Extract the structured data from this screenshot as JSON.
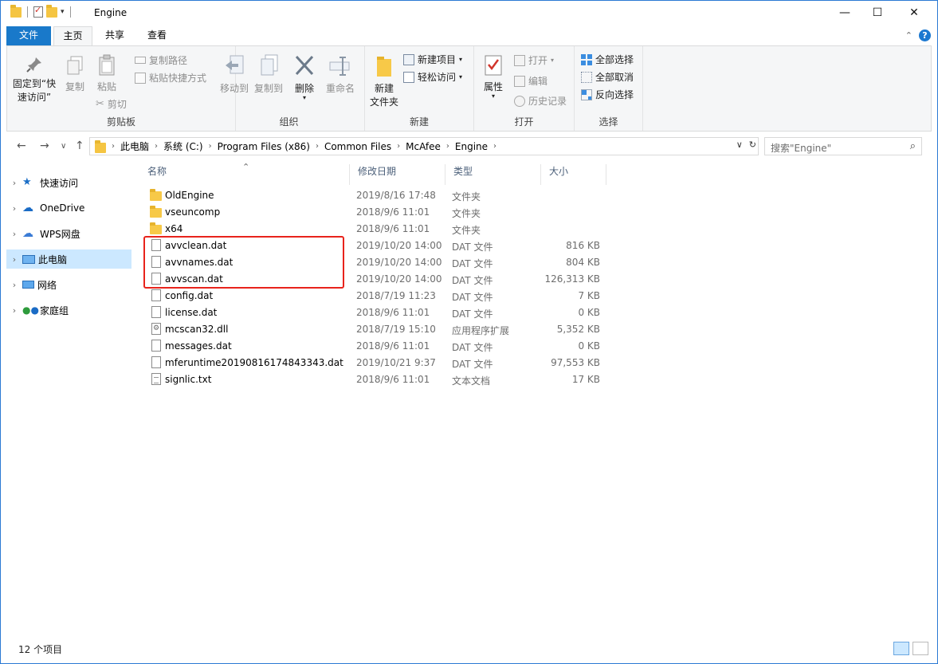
{
  "window": {
    "title": "Engine",
    "minimize_icon": "minimize-icon",
    "maximize_icon": "maximize-icon",
    "close_icon": "close-icon"
  },
  "tabs": {
    "file": "文件",
    "home": "主页",
    "share": "共享",
    "view": "查看"
  },
  "ribbon": {
    "pin_label_1": "固定到“快",
    "pin_label_2": "速访问”",
    "copy": "复制",
    "paste": "粘贴",
    "copy_path": "复制路径",
    "paste_shortcut": "粘贴快捷方式",
    "cut": "剪切",
    "clipboard_group": "剪贴板",
    "move_to": "移动到",
    "copy_to": "复制到",
    "delete": "删除",
    "rename": "重命名",
    "organize_group": "组织",
    "new_folder_1": "新建",
    "new_folder_2": "文件夹",
    "new_item": "新建项目",
    "easy_access": "轻松访问",
    "new_group": "新建",
    "properties": "属性",
    "open": "打开",
    "edit": "编辑",
    "history": "历史记录",
    "open_group": "打开",
    "select_all": "全部选择",
    "select_none": "全部取消",
    "invert_selection": "反向选择",
    "select_group": "选择"
  },
  "address": {
    "crumbs": [
      "此电脑",
      "系统 (C:)",
      "Program Files (x86)",
      "Common Files",
      "McAfee",
      "Engine"
    ]
  },
  "search": {
    "placeholder": "搜索\"Engine\""
  },
  "sidebar": {
    "items": [
      {
        "label": "快速访问",
        "icon": "star-icon"
      },
      {
        "label": "OneDrive",
        "icon": "cloud-icon"
      },
      {
        "label": "WPS网盘",
        "icon": "cloud-outline-icon"
      },
      {
        "label": "此电脑",
        "icon": "computer-icon"
      },
      {
        "label": "网络",
        "icon": "network-icon"
      },
      {
        "label": "家庭组",
        "icon": "homegroup-icon"
      }
    ]
  },
  "columns": {
    "name": "名称",
    "date": "修改日期",
    "type": "类型",
    "size": "大小"
  },
  "files": [
    {
      "name": "OldEngine",
      "date": "2019/8/16 17:48",
      "type": "文件夹",
      "size": "",
      "icon": "folder"
    },
    {
      "name": "vseuncomp",
      "date": "2018/9/6 11:01",
      "type": "文件夹",
      "size": "",
      "icon": "folder"
    },
    {
      "name": "x64",
      "date": "2018/9/6 11:01",
      "type": "文件夹",
      "size": "",
      "icon": "folder"
    },
    {
      "name": "avvclean.dat",
      "date": "2019/10/20 14:00",
      "type": "DAT 文件",
      "size": "816 KB",
      "icon": "file"
    },
    {
      "name": "avvnames.dat",
      "date": "2019/10/20 14:00",
      "type": "DAT 文件",
      "size": "804 KB",
      "icon": "file"
    },
    {
      "name": "avvscan.dat",
      "date": "2019/10/20 14:00",
      "type": "DAT 文件",
      "size": "126,313 KB",
      "icon": "file"
    },
    {
      "name": "config.dat",
      "date": "2018/7/19 11:23",
      "type": "DAT 文件",
      "size": "7 KB",
      "icon": "file"
    },
    {
      "name": "license.dat",
      "date": "2018/9/6 11:01",
      "type": "DAT 文件",
      "size": "0 KB",
      "icon": "file"
    },
    {
      "name": "mcscan32.dll",
      "date": "2018/7/19 15:10",
      "type": "应用程序扩展",
      "size": "5,352 KB",
      "icon": "dll"
    },
    {
      "name": "messages.dat",
      "date": "2018/9/6 11:01",
      "type": "DAT 文件",
      "size": "0 KB",
      "icon": "file"
    },
    {
      "name": "mferuntime20190816174843343.dat",
      "date": "2019/10/21 9:37",
      "type": "DAT 文件",
      "size": "97,553 KB",
      "icon": "file"
    },
    {
      "name": "signlic.txt",
      "date": "2018/9/6 11:01",
      "type": "文本文档",
      "size": "17 KB",
      "icon": "txt"
    }
  ],
  "status": {
    "count": "12 个项目"
  },
  "colors": {
    "accent": "#1979ca",
    "highlight_box": "#e8231c",
    "selection": "#cce8ff"
  }
}
